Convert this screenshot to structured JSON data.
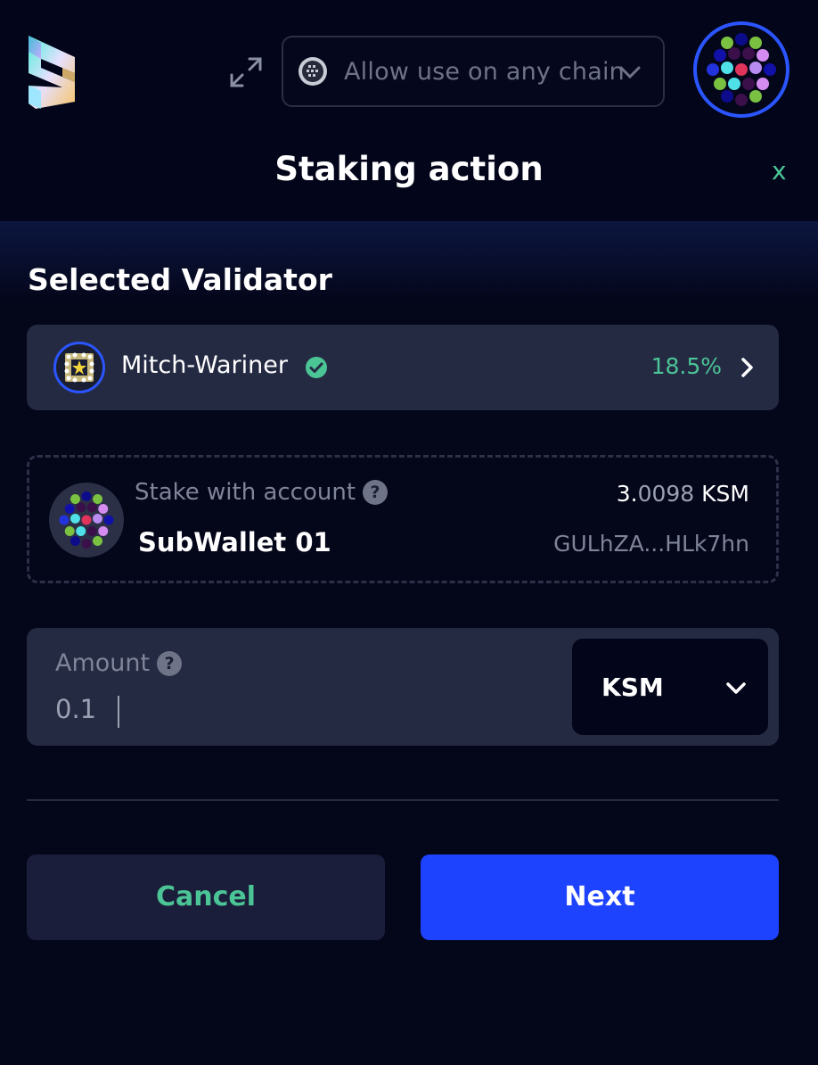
{
  "header": {
    "chain_select_label": "Allow use on any chain",
    "title": "Staking action",
    "close_label": "x"
  },
  "validator_section": {
    "title": "Selected Validator",
    "name": "Mitch-Wariner",
    "rate": "18.5%"
  },
  "account": {
    "label": "Stake with account",
    "help": "?",
    "balance_int": "3.",
    "balance_dec": "0098",
    "balance_unit": "KSM",
    "name": "SubWallet 01",
    "address": "GULhZA...HLk7hn"
  },
  "amount": {
    "label": "Amount",
    "help": "?",
    "value": "0.1",
    "token": "KSM"
  },
  "buttons": {
    "cancel": "Cancel",
    "next": "Next"
  },
  "colors": {
    "accent_green": "#4bc496",
    "primary_blue": "#1e43ff",
    "background": "#04061a",
    "card": "#252a43"
  },
  "icons": {
    "logo": "subwallet-logo-icon",
    "expand": "expand-icon",
    "chain": "chain-network-icon",
    "verified": "check-circle-icon",
    "chevron_right": "chevron-right-icon",
    "chevron_down": "chevron-down-icon",
    "help": "question-circle-icon"
  }
}
